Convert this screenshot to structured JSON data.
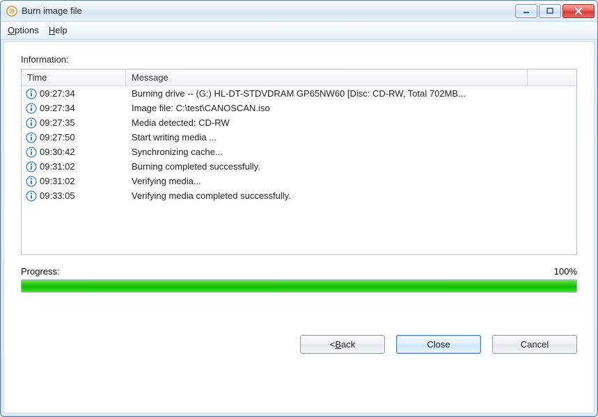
{
  "window": {
    "title": "Burn image file"
  },
  "menubar": {
    "options": "Options",
    "help": "Help"
  },
  "info": {
    "label": "Information:",
    "columns": {
      "time": "Time",
      "message": "Message"
    },
    "rows": [
      {
        "time": "09:27:34",
        "message": "Burning drive -- (G:) HL-DT-STDVDRAM GP65NW60 [Disc: CD-RW, Total 702MB..."
      },
      {
        "time": "09:27:34",
        "message": "Image file:  C:\\test\\CANOSCAN.iso"
      },
      {
        "time": "09:27:35",
        "message": "Media detected: CD-RW"
      },
      {
        "time": "09:27:50",
        "message": "Start writing media ..."
      },
      {
        "time": "09:30:42",
        "message": "Synchronizing cache..."
      },
      {
        "time": "09:31:02",
        "message": "Burning completed successfully."
      },
      {
        "time": "09:31:02",
        "message": "Verifying media..."
      },
      {
        "time": "09:33:05",
        "message": "Verifying media completed successfully."
      }
    ]
  },
  "progress": {
    "label": "Progress:",
    "percent_text": "100%",
    "percent": 100
  },
  "buttons": {
    "back": "< Back",
    "close": "Close",
    "cancel": "Cancel"
  }
}
